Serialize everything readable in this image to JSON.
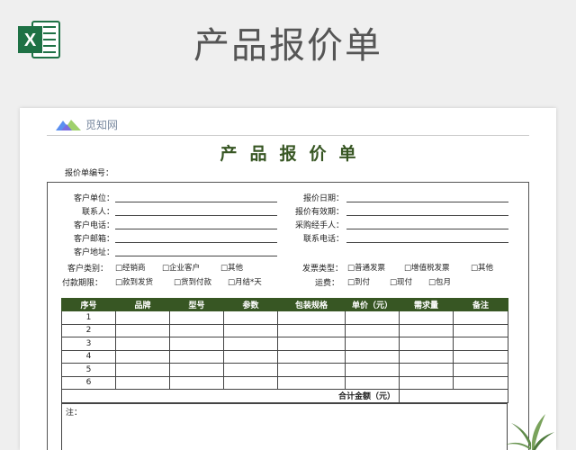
{
  "banner": {
    "title": "产品报价单",
    "icon": "excel-icon",
    "icon_letter": "X",
    "icon_color": "#1e7145"
  },
  "logo": {
    "text": "觅知网",
    "icon": "mizhi-logo-icon"
  },
  "document": {
    "title": "产品报价单",
    "number_label": "报价单编号：",
    "accent_color": "#375623",
    "fields_left": [
      "客户单位：",
      "联系人：",
      "客户电话：",
      "客户邮箱：",
      "客户地址："
    ],
    "fields_right": [
      "报价日期：",
      "报价有效期：",
      "采购经手人：",
      "联系电话："
    ],
    "customer_type": {
      "label": "客户类别：",
      "options": [
        "□经销商",
        "□企业客户",
        "□其他"
      ]
    },
    "invoice_type": {
      "label": "发票类型：",
      "options": [
        "□普通发票",
        "□增值税发票",
        "□其他"
      ]
    },
    "payment_terms": {
      "label": "付款期限：",
      "options": [
        "□款到发货",
        "□货到付款",
        "□月结*天"
      ]
    },
    "freight": {
      "label": "运费：",
      "options": [
        "□到付",
        "□现付",
        "□包月"
      ]
    },
    "table": {
      "headers": [
        "序号",
        "品牌",
        "型号",
        "参数",
        "包装规格",
        "单价（元）",
        "需求量",
        "备注"
      ],
      "rows": [
        "1",
        "2",
        "3",
        "4",
        "5",
        "6"
      ],
      "total_label": "合计金额（元）"
    },
    "note_label": "注："
  }
}
